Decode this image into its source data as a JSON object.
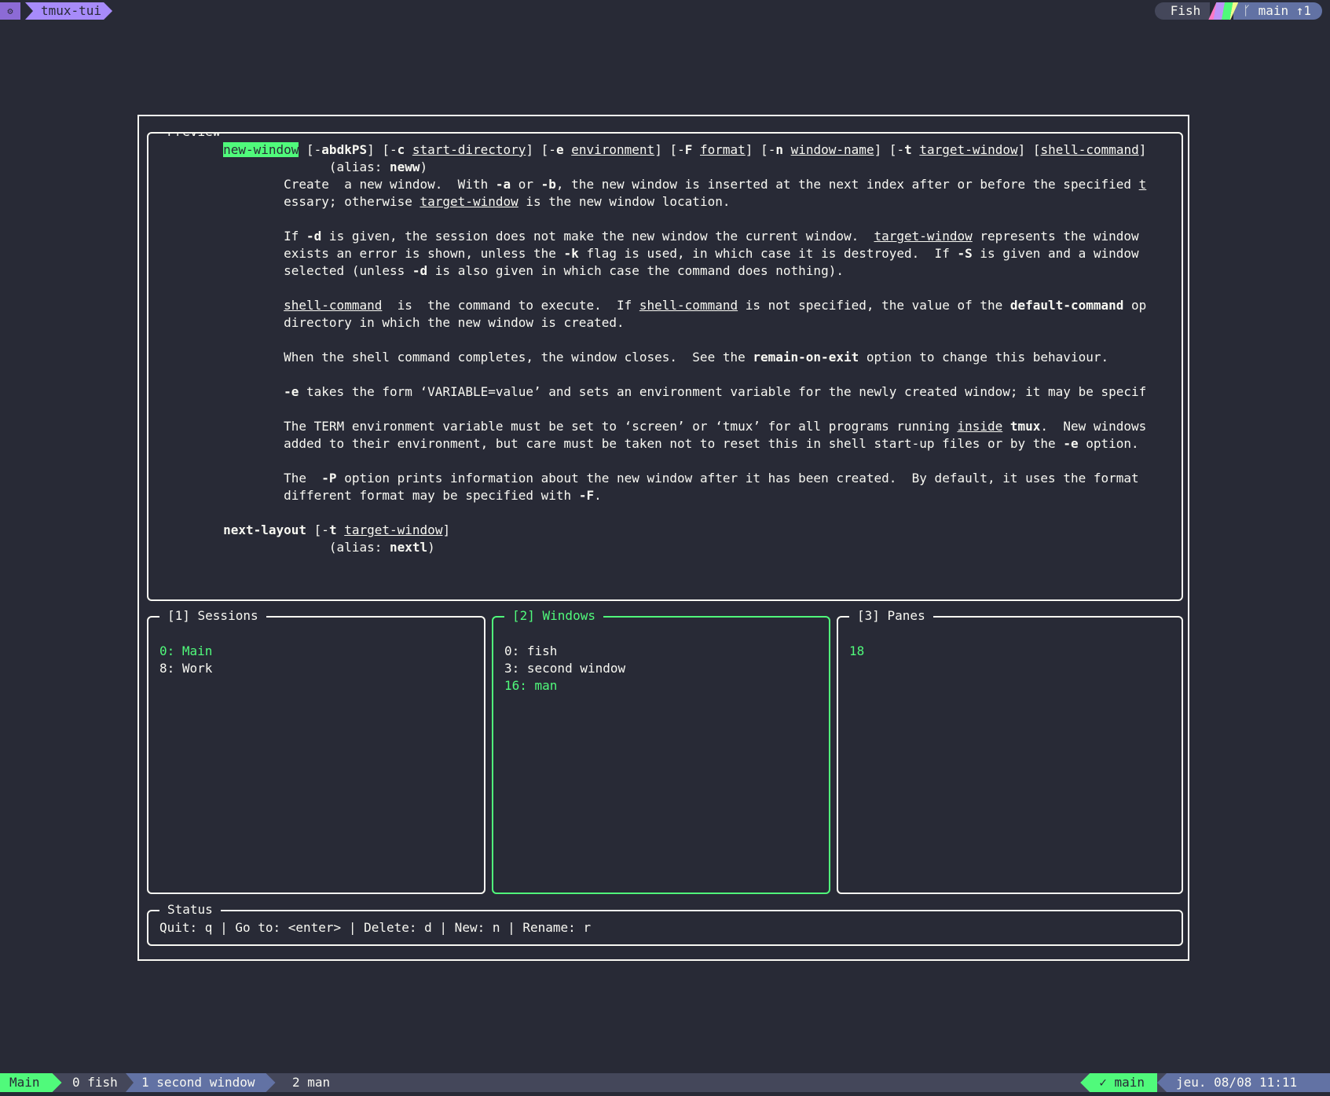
{
  "topbar": {
    "gear_icon": "⚙",
    "app_name": "tmux-tui",
    "shell": "Fish",
    "branch_icon": "ᚴ",
    "branch": "main",
    "ahead": "↑1"
  },
  "preview": {
    "title": "Preview",
    "lines": [
      [
        {
          "t": "        "
        },
        {
          "t": "new-window",
          "c": "hl"
        },
        {
          "t": " [-"
        },
        {
          "t": "abdkPS",
          "c": "b"
        },
        {
          "t": "] [-"
        },
        {
          "t": "c",
          "c": "b"
        },
        {
          "t": " "
        },
        {
          "t": "start-directory",
          "c": "u"
        },
        {
          "t": "] [-"
        },
        {
          "t": "e",
          "c": "b"
        },
        {
          "t": " "
        },
        {
          "t": "environment",
          "c": "u"
        },
        {
          "t": "] [-"
        },
        {
          "t": "F",
          "c": "b"
        },
        {
          "t": " "
        },
        {
          "t": "format",
          "c": "u"
        },
        {
          "t": "] [-"
        },
        {
          "t": "n",
          "c": "b"
        },
        {
          "t": " "
        },
        {
          "t": "window-name",
          "c": "u"
        },
        {
          "t": "] [-"
        },
        {
          "t": "t",
          "c": "b"
        },
        {
          "t": " "
        },
        {
          "t": "target-window",
          "c": "u"
        },
        {
          "t": "] ["
        },
        {
          "t": "shell-command",
          "c": "u"
        },
        {
          "t": "]"
        }
      ],
      [
        {
          "t": "                      (alias: "
        },
        {
          "t": "neww",
          "c": "b"
        },
        {
          "t": ")"
        }
      ],
      [
        {
          "t": "                Create  a new window.  With "
        },
        {
          "t": "-a",
          "c": "b"
        },
        {
          "t": " or "
        },
        {
          "t": "-b",
          "c": "b"
        },
        {
          "t": ", the new window is inserted at the next index after or before the specified "
        },
        {
          "t": "t",
          "c": "u"
        }
      ],
      [
        {
          "t": "                essary; otherwise "
        },
        {
          "t": "target-window",
          "c": "u"
        },
        {
          "t": " is the new window location."
        }
      ],
      [
        {
          "t": ""
        }
      ],
      [
        {
          "t": "                If "
        },
        {
          "t": "-d",
          "c": "b"
        },
        {
          "t": " is given, the session does not make the new window the current window.  "
        },
        {
          "t": "target-window",
          "c": "u"
        },
        {
          "t": " represents the window"
        }
      ],
      [
        {
          "t": "                exists an error is shown, unless the "
        },
        {
          "t": "-k",
          "c": "b"
        },
        {
          "t": " flag is used, in which case it is destroyed.  If "
        },
        {
          "t": "-S",
          "c": "b"
        },
        {
          "t": " is given and a window"
        }
      ],
      [
        {
          "t": "                selected (unless "
        },
        {
          "t": "-d",
          "c": "b"
        },
        {
          "t": " is also given in which case the command does nothing)."
        }
      ],
      [
        {
          "t": ""
        }
      ],
      [
        {
          "t": "                "
        },
        {
          "t": "shell-command",
          "c": "u"
        },
        {
          "t": "  is  the command to execute.  If "
        },
        {
          "t": "shell-command",
          "c": "u"
        },
        {
          "t": " is not specified, the value of the "
        },
        {
          "t": "default-command",
          "c": "b"
        },
        {
          "t": " op"
        }
      ],
      [
        {
          "t": "                directory in which the new window is created."
        }
      ],
      [
        {
          "t": ""
        }
      ],
      [
        {
          "t": "                When the shell command completes, the window closes.  See the "
        },
        {
          "t": "remain-on-exit",
          "c": "b"
        },
        {
          "t": " option to change this behaviour."
        }
      ],
      [
        {
          "t": ""
        }
      ],
      [
        {
          "t": "                "
        },
        {
          "t": "-e",
          "c": "b"
        },
        {
          "t": " takes the form ‘VARIABLE=value’ and sets an environment variable for the newly created window; it may be specif"
        }
      ],
      [
        {
          "t": ""
        }
      ],
      [
        {
          "t": "                The TERM environment variable must be set to ‘screen’ or ‘tmux’ for all programs running "
        },
        {
          "t": "inside",
          "c": "u"
        },
        {
          "t": " "
        },
        {
          "t": "tmux",
          "c": "b"
        },
        {
          "t": ".  New windows"
        }
      ],
      [
        {
          "t": "                added to their environment, but care must be taken not to reset this in shell start-up files or by the "
        },
        {
          "t": "-e",
          "c": "b"
        },
        {
          "t": " option."
        }
      ],
      [
        {
          "t": ""
        }
      ],
      [
        {
          "t": "                The  "
        },
        {
          "t": "-P",
          "c": "b"
        },
        {
          "t": " option prints information about the new window after it has been created.  By default, it uses the format"
        }
      ],
      [
        {
          "t": "                different format may be specified with "
        },
        {
          "t": "-F",
          "c": "b"
        },
        {
          "t": "."
        }
      ],
      [
        {
          "t": ""
        }
      ],
      [
        {
          "t": "        "
        },
        {
          "t": "next-layout",
          "c": "b"
        },
        {
          "t": " [-"
        },
        {
          "t": "t",
          "c": "b"
        },
        {
          "t": " "
        },
        {
          "t": "target-window",
          "c": "u"
        },
        {
          "t": "]"
        }
      ],
      [
        {
          "t": "                      (alias: "
        },
        {
          "t": "nextl",
          "c": "b"
        },
        {
          "t": ")"
        }
      ]
    ]
  },
  "sessions": {
    "title": "[1] Sessions",
    "items": [
      {
        "label": "0: Main",
        "selected": true
      },
      {
        "label": "8: Work",
        "selected": false
      }
    ]
  },
  "windows": {
    "title": "[2] Windows",
    "items": [
      {
        "label": "0: fish",
        "selected": false
      },
      {
        "label": "3: second window",
        "selected": false
      },
      {
        "label": "16: man",
        "selected": true
      }
    ]
  },
  "panes": {
    "title": "[3] Panes",
    "items": [
      {
        "label": "18",
        "selected": true
      }
    ]
  },
  "status": {
    "title": "Status",
    "line": "Quit: q | Go to: <enter> | Delete: d | New: n | Rename: r"
  },
  "tmux_bar": {
    "session": "Main",
    "win0": "0 fish",
    "win1": "1 second window",
    "win2": "2 man",
    "git": "✓ main",
    "datetime": "jeu. 08/08 11:11"
  },
  "colors": {
    "background": "#282a36",
    "foreground": "#f8f8f2",
    "accent_green": "#50fa7b",
    "accent_purple": "#a78bfa",
    "bar_grey": "#44475a",
    "bar_blue": "#6272a4"
  }
}
